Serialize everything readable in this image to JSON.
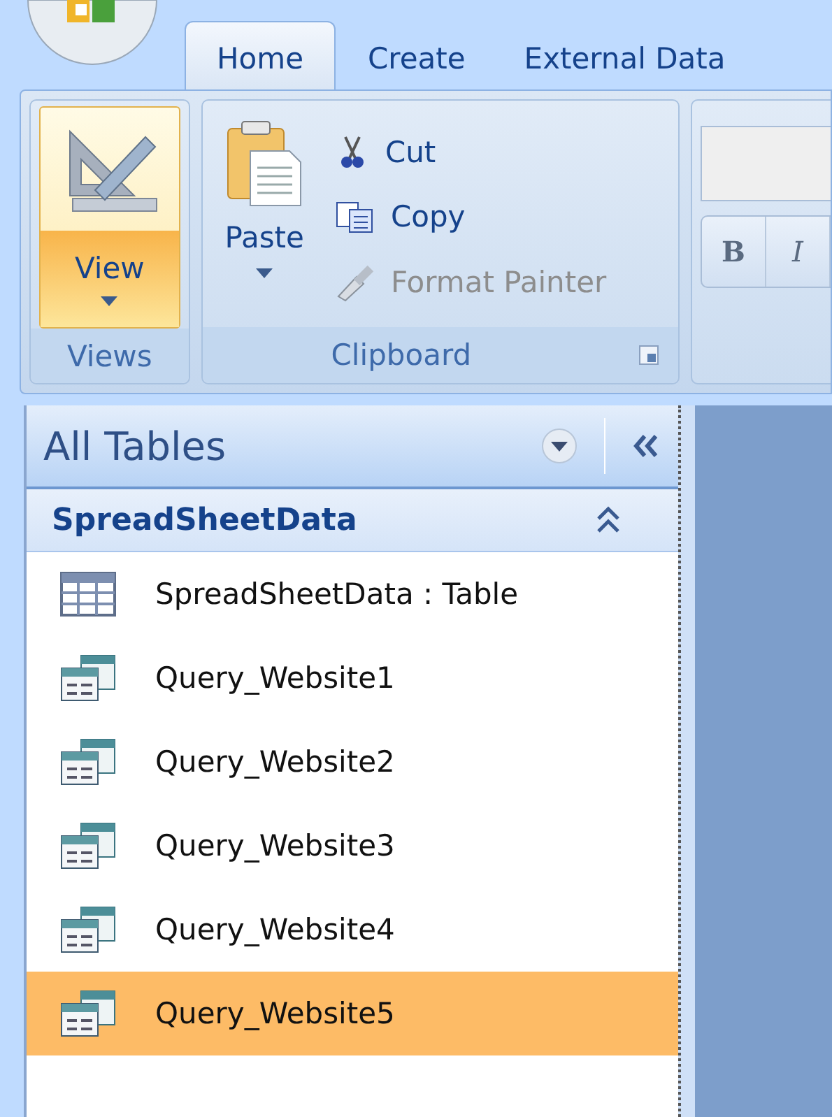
{
  "tabs": [
    {
      "label": "Home",
      "selected": true
    },
    {
      "label": "Create",
      "selected": false
    },
    {
      "label": "External Data",
      "selected": false
    }
  ],
  "ribbon": {
    "views": {
      "title": "Views",
      "button": "View",
      "hover": true
    },
    "clipboard": {
      "title": "Clipboard",
      "paste": "Paste",
      "items": [
        {
          "kind": "cut",
          "label": "Cut",
          "disabled": false
        },
        {
          "kind": "copy",
          "label": "Copy",
          "disabled": false
        },
        {
          "kind": "format-painter",
          "label": "Format Painter",
          "disabled": true
        }
      ]
    },
    "font": {
      "buttons": [
        {
          "kind": "bold",
          "label": "B"
        },
        {
          "kind": "italic",
          "label": "I"
        }
      ]
    }
  },
  "nav": {
    "title": "All Tables",
    "group": {
      "title": "SpreadSheetData",
      "expanded": true,
      "items": [
        {
          "kind": "table",
          "label": "SpreadSheetData : Table",
          "selected": false
        },
        {
          "kind": "query",
          "label": "Query_Website1",
          "selected": false
        },
        {
          "kind": "query",
          "label": "Query_Website2",
          "selected": false
        },
        {
          "kind": "query",
          "label": "Query_Website3",
          "selected": false
        },
        {
          "kind": "query",
          "label": "Query_Website4",
          "selected": false
        },
        {
          "kind": "query",
          "label": "Query_Website5",
          "selected": true
        }
      ]
    }
  }
}
